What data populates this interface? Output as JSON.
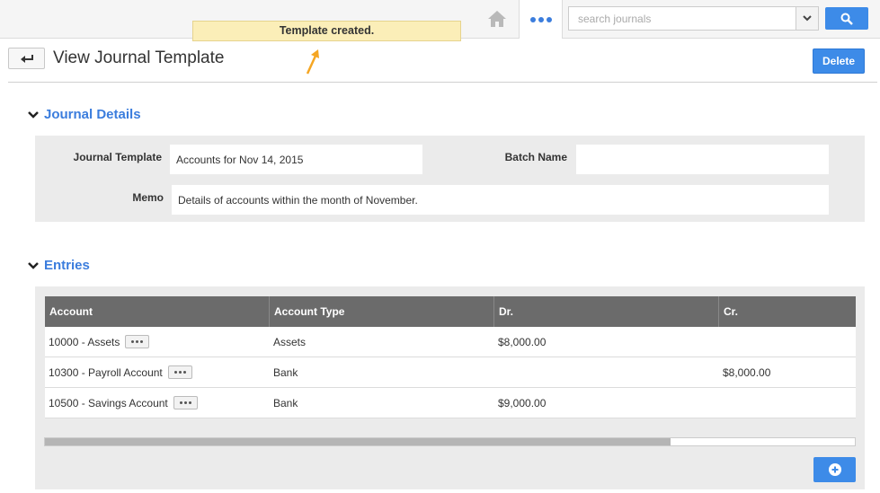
{
  "topbar": {
    "search_placeholder": "search journals"
  },
  "notification": {
    "message": "Template created."
  },
  "header": {
    "title": "View Journal Template",
    "delete_label": "Delete"
  },
  "journal_details": {
    "section_title": "Journal Details",
    "journal_template_label": "Journal Template",
    "journal_template_value": "Accounts for Nov 14, 2015",
    "batch_name_label": "Batch Name",
    "batch_name_value": "",
    "memo_label": "Memo",
    "memo_value": "Details of accounts within the month of November."
  },
  "entries": {
    "section_title": "Entries",
    "columns": [
      "Account",
      "Account Type",
      "Dr.",
      "Cr."
    ],
    "rows": [
      {
        "account": "10000 - Assets",
        "type": "Assets",
        "dr": "$8,000.00",
        "cr": ""
      },
      {
        "account": "10300 - Payroll Account",
        "type": "Bank",
        "dr": "",
        "cr": "$8,000.00"
      },
      {
        "account": "10500 - Savings Account",
        "type": "Bank",
        "dr": "$9,000.00",
        "cr": ""
      }
    ]
  },
  "icons": {
    "home": "home-icon",
    "more": "more-dots-icon",
    "dropdown": "chevron-down-icon",
    "search": "search-icon",
    "back": "back-arrow-icon",
    "add": "plus-circle-icon",
    "annotation": "annotation-arrow"
  },
  "colors": {
    "accent": "#3d8be8",
    "link": "#3b7ddd",
    "toast_bg": "#fbeeb8",
    "table_header": "#6b6b6b"
  }
}
